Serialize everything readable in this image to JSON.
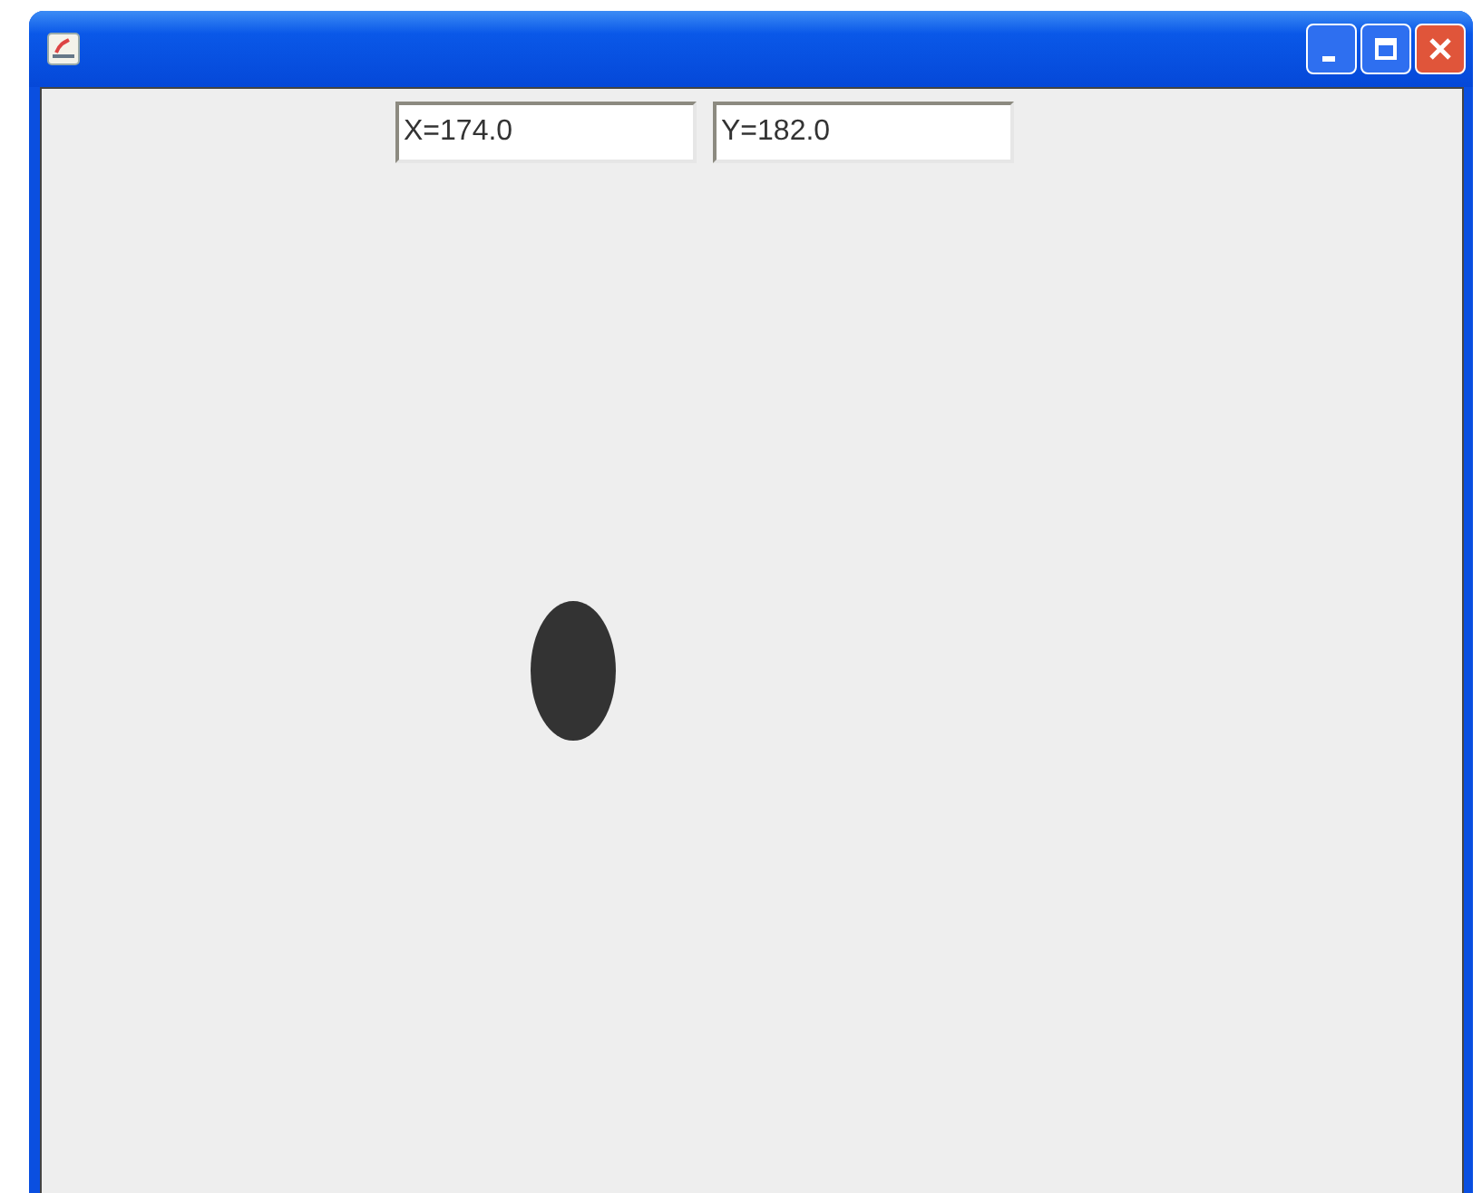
{
  "fields": [
    {
      "value": "X=174.0"
    },
    {
      "value": "Y=182.0"
    }
  ]
}
